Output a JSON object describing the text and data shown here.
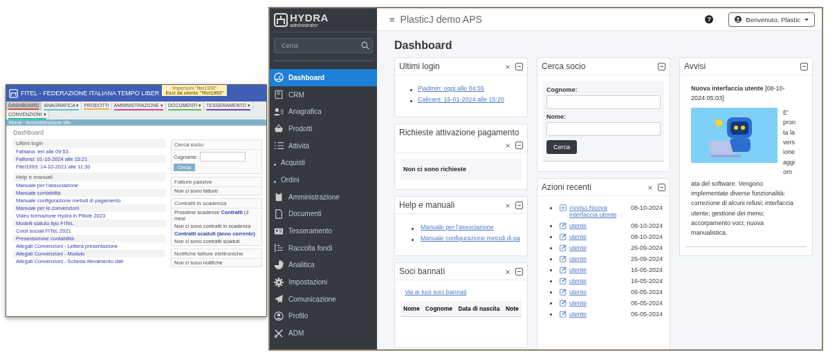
{
  "background_screenshot": {
    "title": "FITEL - FEDERAZIONE ITALIANA TEMPO LIBER",
    "impersonation": [
      "Impersoni \"fitel1993\"",
      "Esci da utente \"fitel1993\""
    ],
    "tabs": [
      {
        "label": "DASHBOARD",
        "selected": true,
        "color": "#d9534f"
      },
      {
        "label": "ANAGRAFICA ▾",
        "selected": false,
        "color": "#5bc0de"
      },
      {
        "label": "PRODOTTI",
        "selected": false,
        "color": "#f0ad4e"
      },
      {
        "label": "AMMINISTRAZIONE ▾",
        "selected": false,
        "color": "#e83e8c"
      },
      {
        "label": "DOCUMENTI ▾",
        "selected": false,
        "color": "#5cb85c"
      },
      {
        "label": "TESSERAMENTO ▾",
        "selected": false,
        "color": "#6f42c1"
      },
      {
        "label": "CONVENZIONI ▾",
        "selected": false,
        "color": "#20c997"
      }
    ],
    "breadcrumb": "Home · Amministrazione sito",
    "page_title": "Dashboard",
    "login": {
      "title": "Ultimi login",
      "items": [
        "Fabiana: ieri alle 09:53",
        "Falfonsi: 01-10-2024 alle 15:21",
        "Fitel1993: 14-10-2021 alle 11:30"
      ]
    },
    "help": {
      "title": "Help e manuali",
      "items": [
        "Manuale per l'associazione",
        "Manuale contabilità",
        "Manuale configurazione metodi di pagamento",
        "Manuale per le convenzioni",
        "Video formazione Hydra in Pillole 2023",
        "Modelli statuto tipo FITeL",
        "Corsi sociali FITeL 2021",
        "Presentazione contabilità",
        "Allegati Convenzioni - Lettera presentazione",
        "Allegati Convenzioni - Modulo",
        "Allegati Convenzioni - Scheda rilevamento dati"
      ]
    },
    "search": {
      "title": "Cerca socio",
      "label": "Cognome:",
      "button": "Cerca"
    },
    "panels": [
      {
        "title": "Fatture passive",
        "lines": [
          "Non ci sono fatture"
        ]
      },
      {
        "title": "Contratti in scadenza",
        "lines": [
          "Prossime scadenze **Contratti** (3 mesi",
          "Non ci sono contratti in scadenza",
          "**Contratti scaduti (anno corrente)**",
          "Non ci sono contratti scaduti"
        ]
      },
      {
        "title": "Notifiche fatture elettroniche",
        "lines": [
          "Non ci sono notifiche"
        ]
      }
    ]
  },
  "window": {
    "sidebar": {
      "logo": "HYDRA",
      "logo_sub": "administrator",
      "search_placeholder": "Cerca",
      "items": [
        {
          "label": "Dashboard",
          "selected": true,
          "kind": "main"
        },
        {
          "label": "CRM",
          "selected": false,
          "kind": "main"
        },
        {
          "label": "Anagrafica",
          "selected": false,
          "kind": "main"
        },
        {
          "label": "Prodotti",
          "selected": false,
          "kind": "main"
        },
        {
          "label": "Attività",
          "selected": false,
          "kind": "main"
        },
        {
          "label": "Acquisti",
          "selected": false,
          "kind": "sub"
        },
        {
          "label": "Ordini",
          "selected": false,
          "kind": "sub"
        },
        {
          "label": "Amministrazione",
          "selected": false,
          "kind": "main"
        },
        {
          "label": "Documenti",
          "selected": false,
          "kind": "main"
        },
        {
          "label": "Tesseramento",
          "selected": false,
          "kind": "main"
        },
        {
          "label": "Raccolta fondi",
          "selected": false,
          "kind": "main"
        },
        {
          "label": "Analitica",
          "selected": false,
          "kind": "main"
        },
        {
          "label": "Impostazioni",
          "selected": false,
          "kind": "main"
        },
        {
          "label": "Comunicazione",
          "selected": false,
          "kind": "main"
        },
        {
          "label": "Profilo",
          "selected": false,
          "kind": "main"
        },
        {
          "label": "ADM",
          "selected": false,
          "kind": "main"
        }
      ]
    },
    "header": {
      "menu_glyph": "≡",
      "title": "PlasticJ demo APS",
      "help_glyph": "?",
      "user_button": "Benvenuto, Plastic"
    },
    "page_title": "Dashboard",
    "last_login": {
      "title": "Ultimi login",
      "closable": true,
      "items": [
        "Pjadmin: oggi alle 04:55",
        "Calicant: 15-01-2024 alle 15:20"
      ]
    },
    "payment_requests": {
      "title": "Richieste attivazione pagamento",
      "closable": true,
      "message": "Non ci sono richieste"
    },
    "help": {
      "title": "Help e manuali",
      "closable": true,
      "items": [
        "Manuale per l'associazione",
        "Manuale configurazione metodi di pa"
      ]
    },
    "banned": {
      "title": "Soci bannati",
      "closable": true,
      "link": "Vai ai tuoi soci bannati",
      "columns": [
        "Nome",
        "Cognome",
        "Data di nascita",
        "Note"
      ]
    },
    "member_search": {
      "title": "Cerca socio",
      "closable": false,
      "fields": [
        {
          "label": "Cognome:"
        },
        {
          "label": "Nome:"
        }
      ],
      "button": "Cerca"
    },
    "recent": {
      "title": "Azioni recenti",
      "closable": true,
      "items": [
        {
          "kind": "add",
          "label": "Avviso Nuova interfaccia utente",
          "date": "08-10-2024"
        },
        {
          "kind": "edit",
          "label": "utente",
          "date": "08-10-2024"
        },
        {
          "kind": "edit",
          "label": "utente",
          "date": "08-10-2024"
        },
        {
          "kind": "edit",
          "label": "utente",
          "date": "26-09-2024"
        },
        {
          "kind": "edit",
          "label": "utente",
          "date": "26-09-2024"
        },
        {
          "kind": "edit",
          "label": "utente",
          "date": "16-05-2024"
        },
        {
          "kind": "edit",
          "label": "utente",
          "date": "16-05-2024"
        },
        {
          "kind": "edit",
          "label": "utente",
          "date": "06-05-2024"
        },
        {
          "kind": "edit",
          "label": "utente",
          "date": "06-05-2024"
        },
        {
          "kind": "edit",
          "label": "utente",
          "date": "06-05-2024"
        }
      ]
    },
    "notices": {
      "title": "Avvisi",
      "closable": false,
      "heading": "**Nuova interfaccia utente** [08-10-2024 05:03]",
      "body": [
        "E' pronta la versione aggiorn",
        "ata del software. Vengono implementate diverse funzionalità: correzione di alcuni refusi; interfaccia utente; gestione dei menu; accorpamento voci; nuova manualistica."
      ]
    }
  }
}
